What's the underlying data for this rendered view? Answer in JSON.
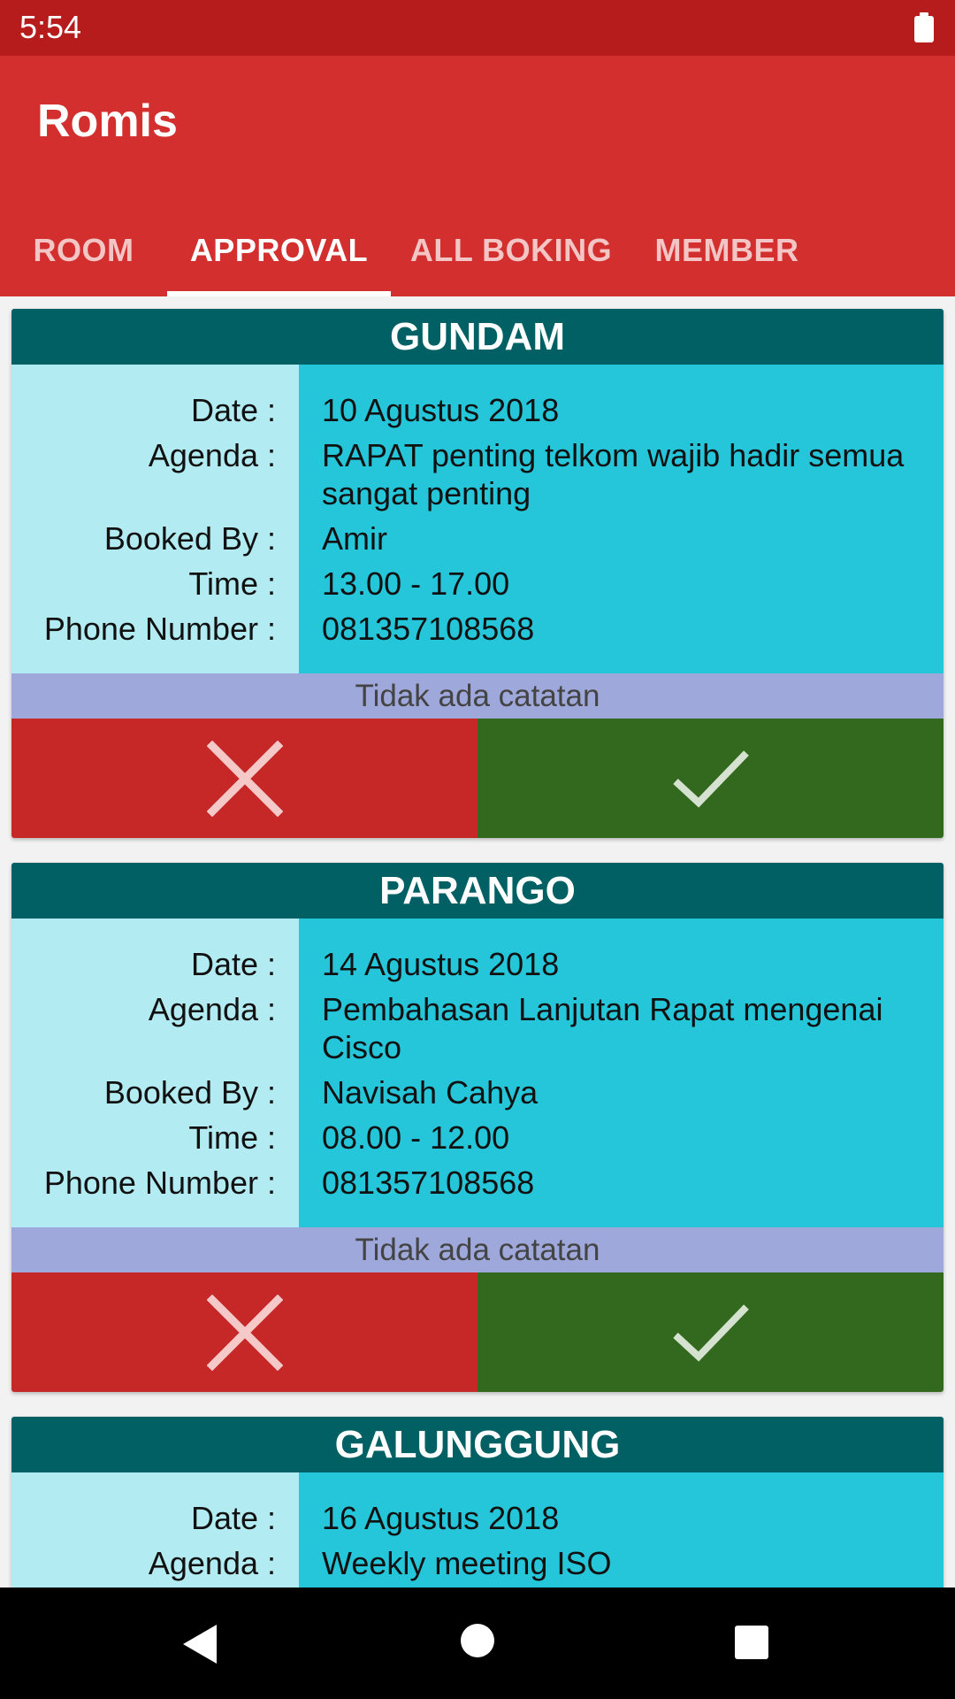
{
  "status_bar": {
    "time": "5:54"
  },
  "app_bar": {
    "title": "Romis",
    "tabs": [
      {
        "label": "ROOM"
      },
      {
        "label": "APPROVAL"
      },
      {
        "label": "ALL BOKING"
      },
      {
        "label": "MEMBER"
      }
    ],
    "active_tab": "APPROVAL"
  },
  "labels": {
    "date": "Date :",
    "agenda": "Agenda :",
    "booked_by": "Booked By :",
    "time": "Time :",
    "phone": "Phone Number :"
  },
  "bookings": [
    {
      "room": "GUNDAM",
      "date": "10 Agustus 2018",
      "agenda": "RAPAT penting telkom wajib hadir semua sangat penting",
      "booked_by": "Amir",
      "time": "13.00 - 17.00",
      "phone": "081357108568",
      "notes": "Tidak ada catatan"
    },
    {
      "room": "PARANGO",
      "date": "14 Agustus 2018",
      "agenda": "Pembahasan Lanjutan Rapat mengenai Cisco",
      "booked_by": "Navisah Cahya",
      "time": "08.00 - 12.00",
      "phone": "081357108568",
      "notes": "Tidak ada catatan"
    },
    {
      "room": "GALUNGGUNG",
      "date": "16 Agustus 2018",
      "agenda": "Weekly meeting ISO"
    }
  ],
  "icons": {
    "reject": "close-icon",
    "approve": "check-icon",
    "battery": "battery-icon"
  },
  "colors": {
    "status_bar": "#b71c1c",
    "app_bar": "#d32f2f",
    "card_header": "#006064",
    "label_bg": "#b2ebf2",
    "value_bg": "#26c6da",
    "notes_bg": "#9fa8da",
    "reject": "#c62828",
    "approve": "#33691e"
  }
}
